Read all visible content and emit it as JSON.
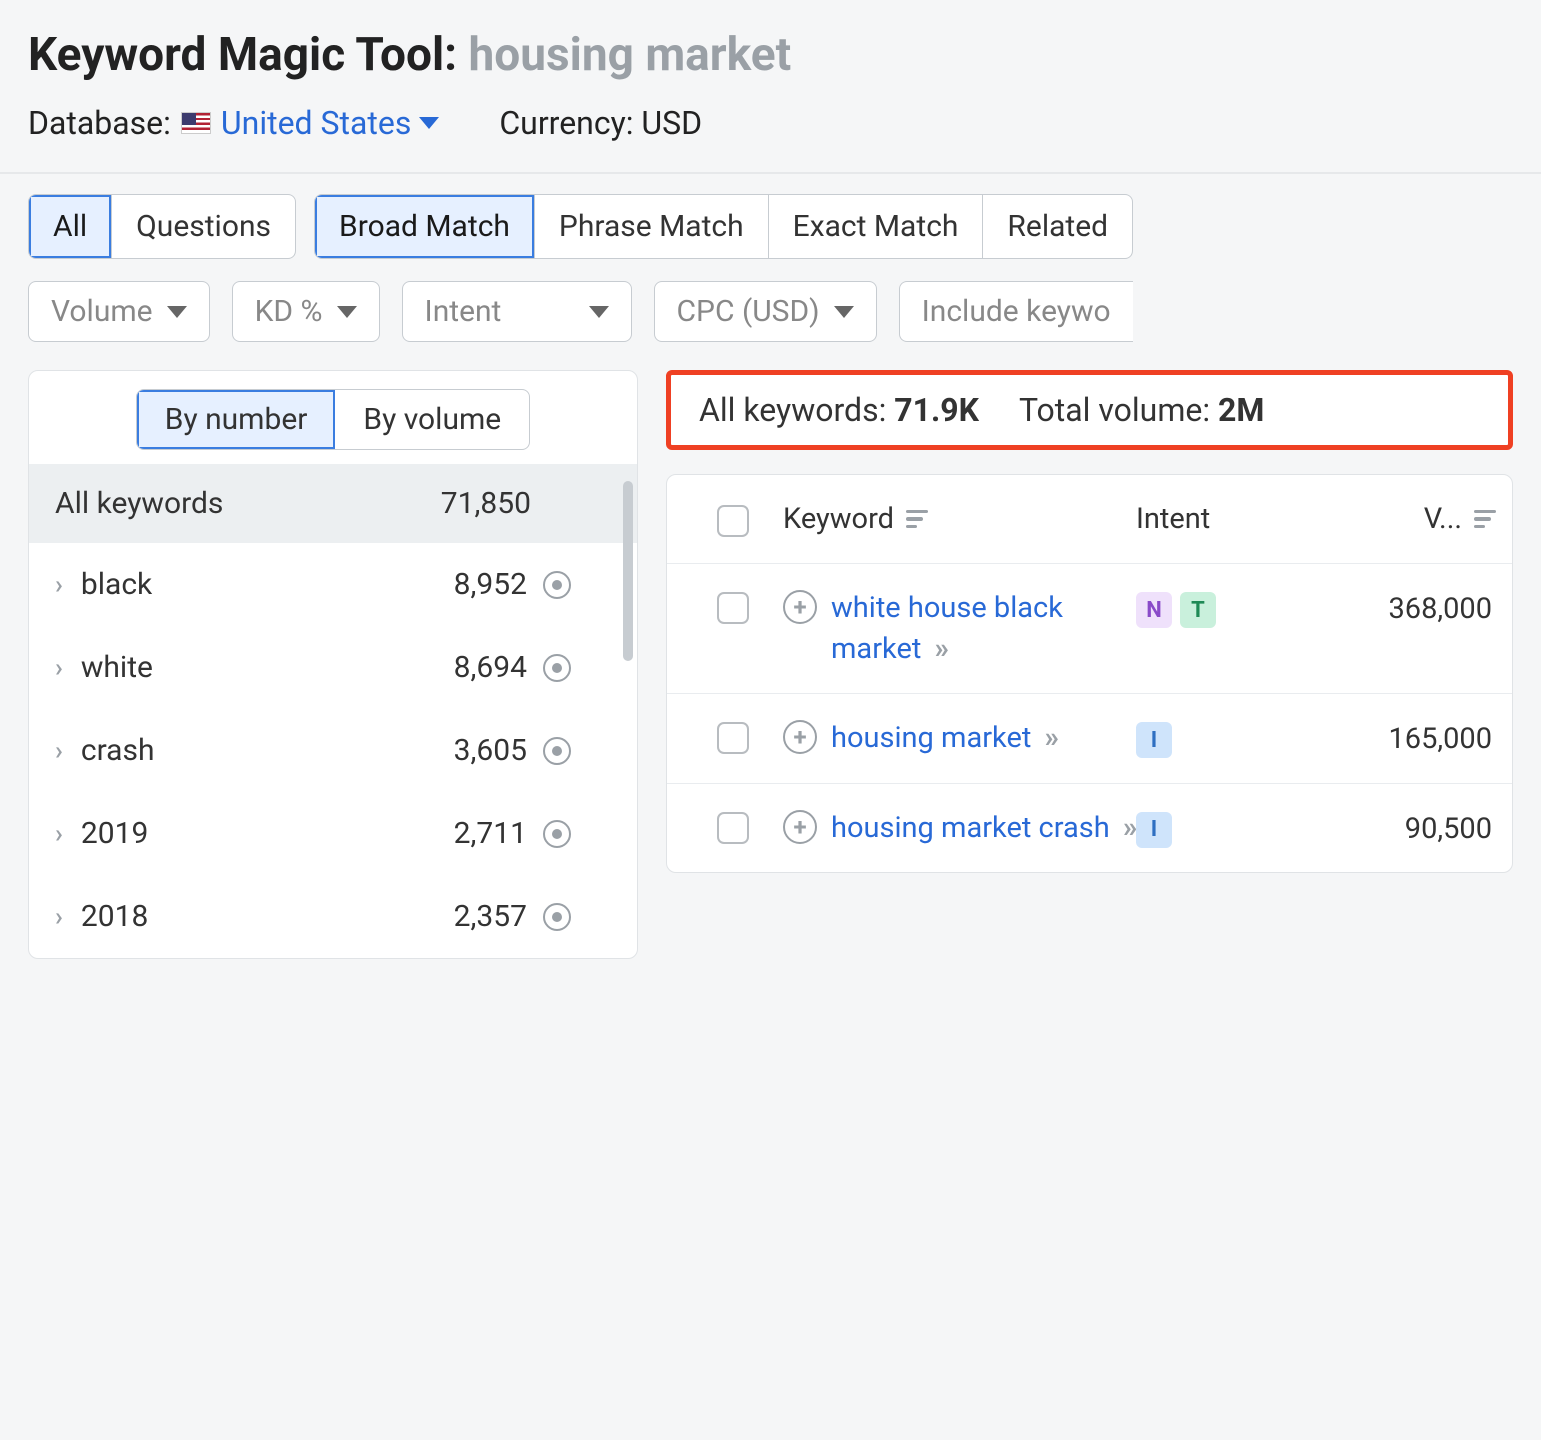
{
  "header": {
    "title_prefix": "Keyword Magic Tool:",
    "query": "housing market",
    "database_label": "Database:",
    "database_value": "United States",
    "currency_label": "Currency:",
    "currency_value": "USD"
  },
  "tabs_type": {
    "all": "All",
    "questions": "Questions"
  },
  "tabs_match": {
    "broad": "Broad Match",
    "phrase": "Phrase Match",
    "exact": "Exact Match",
    "related": "Related"
  },
  "filters": {
    "volume": "Volume",
    "kd": "KD %",
    "intent": "Intent",
    "cpc": "CPC (USD)",
    "include": "Include keywo"
  },
  "sidebar": {
    "toggle_number": "By number",
    "toggle_volume": "By volume",
    "all_label": "All keywords",
    "all_count": "71,850",
    "groups": [
      {
        "name": "black",
        "count": "8,952"
      },
      {
        "name": "white",
        "count": "8,694"
      },
      {
        "name": "crash",
        "count": "3,605"
      },
      {
        "name": "2019",
        "count": "2,711"
      },
      {
        "name": "2018",
        "count": "2,357"
      }
    ]
  },
  "stats": {
    "all_kw_label": "All keywords:",
    "all_kw_value": "71.9K",
    "total_vol_label": "Total volume:",
    "total_vol_value": "2M"
  },
  "table": {
    "columns": {
      "keyword": "Keyword",
      "intent": "Intent",
      "volume": "V..."
    },
    "rows": [
      {
        "keyword": "white house black market",
        "intents": [
          "N",
          "T"
        ],
        "volume": "368,000"
      },
      {
        "keyword": "housing market",
        "intents": [
          "I"
        ],
        "volume": "165,000"
      },
      {
        "keyword": "housing market crash",
        "intents": [
          "I"
        ],
        "volume": "90,500"
      }
    ]
  }
}
